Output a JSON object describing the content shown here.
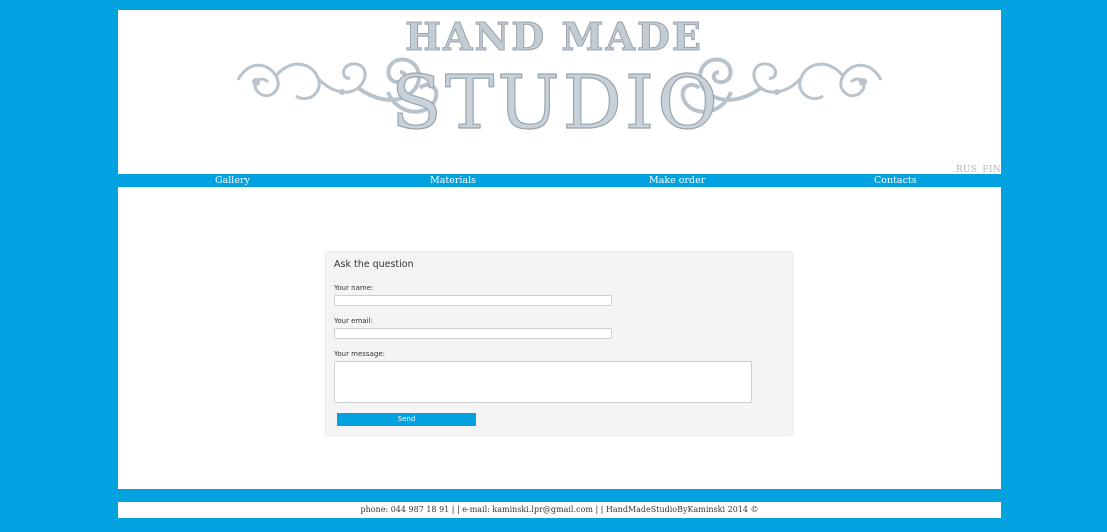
{
  "header": {
    "title_line1": "HAND MADE",
    "title_line2": "STUDIO",
    "languages": [
      "RUS",
      "FIN"
    ]
  },
  "nav": {
    "items": [
      "Gallery",
      "Materials",
      "Make order",
      "Contacts"
    ]
  },
  "form": {
    "title": "Ask the question",
    "name_label": "Your name:",
    "name_value": "",
    "email_label": "Your email:",
    "email_value": "",
    "message_label": "Your message:",
    "message_value": "",
    "send_label": "Send"
  },
  "footer": {
    "text": "phone: 044 987 18 91 | | e-mail: kaminski.lpr@gmail.com | | HandMadeStudioByKaminski 2014 ©"
  },
  "colors": {
    "background": "#02a2e0",
    "logo_text": "#b9c3cc",
    "button": "#02a2e0"
  }
}
